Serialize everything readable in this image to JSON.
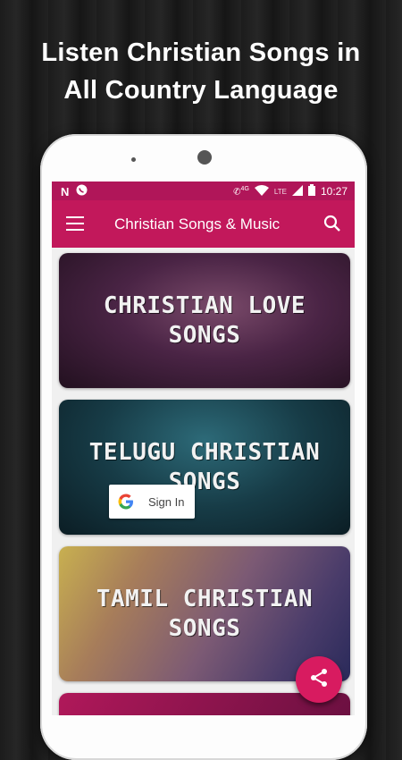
{
  "promo": {
    "line1": "Listen Christian Songs in",
    "line2": "All Country Language"
  },
  "status_bar": {
    "time": "10:27",
    "network_badge": "4G",
    "lte_label": "LTE",
    "left_icons": [
      "n-icon",
      "whatsapp-icon"
    ],
    "right_icons": [
      "call-icon",
      "wifi-icon",
      "signal-icon",
      "battery-icon"
    ]
  },
  "app_bar": {
    "title": "Christian Songs & Music",
    "menu_icon": "hamburger-menu-icon",
    "search_icon": "search-icon",
    "color": "#c2185b"
  },
  "cards": [
    {
      "line1": "CHRISTIAN LOVE",
      "line2": "SONGS"
    },
    {
      "line1": "TELUGU CHRISTIAN",
      "line2": "SONGS"
    },
    {
      "line1": "TAMIL CHRISTIAN",
      "line2": "SONGS"
    }
  ],
  "signin": {
    "label": "Sign In",
    "icon": "google-g-icon"
  },
  "fab": {
    "icon": "share-icon",
    "color": "#d81b60"
  }
}
